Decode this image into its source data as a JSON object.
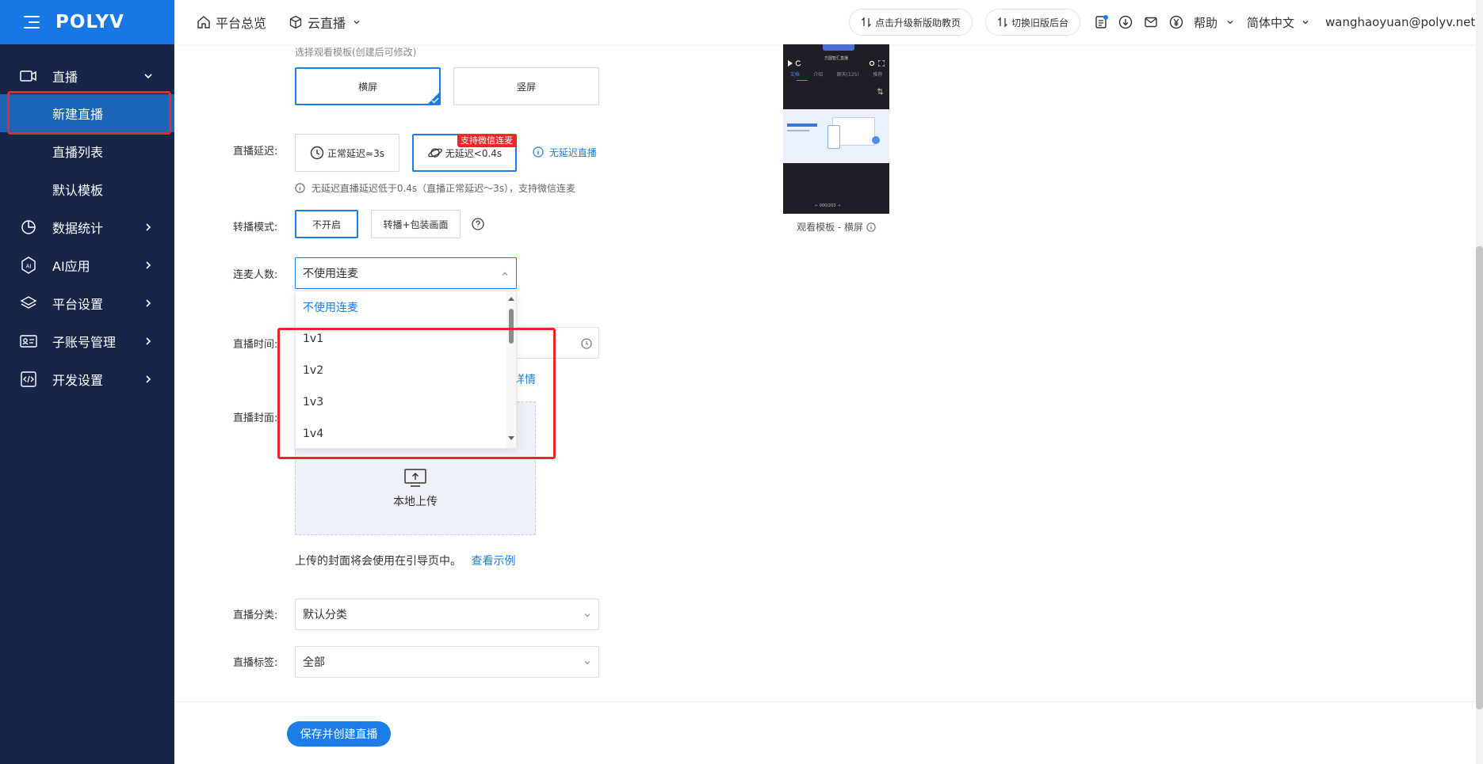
{
  "brand": {
    "logo": "POLYV"
  },
  "sidebar": {
    "sections": [
      {
        "label": "直播",
        "icon": "video-camera-icon",
        "expanded": true,
        "children": [
          {
            "label": "新建直播",
            "active": true
          },
          {
            "label": "直播列表"
          },
          {
            "label": "默认模板"
          }
        ]
      },
      {
        "label": "数据统计",
        "icon": "pie-chart-icon"
      },
      {
        "label": "AI应用",
        "icon": "ai-hexagon-icon"
      },
      {
        "label": "平台设置",
        "icon": "layers-icon"
      },
      {
        "label": "子账号管理",
        "icon": "id-card-icon"
      },
      {
        "label": "开发设置",
        "icon": "code-icon"
      }
    ]
  },
  "topbar": {
    "home": "平台总览",
    "product": "云直播",
    "upgrade_pill": "点击升级新版助教页",
    "old_pill": "切换旧版后台",
    "help": "帮助",
    "language": "简体中文",
    "user": "wanghaoyuan@polyv.net"
  },
  "form": {
    "template_hint": "选择观看模板(创建后可修改)",
    "template_options": [
      "横屏",
      "竖屏"
    ],
    "template_selected": 0,
    "delay_label": "直播延迟:",
    "delay_options": [
      "正常延迟≈3s",
      "无延迟<0.4s"
    ],
    "delay_selected": 1,
    "delay_badge": "支持微信连麦",
    "delay_link": "无延迟直播",
    "delay_note": "无延迟直播延迟低于0.4s（直播正常延迟～3s），支持微信连麦",
    "relay_label": "转播模式:",
    "relay_options": [
      "不开启",
      "转播+包装画面"
    ],
    "relay_selected": 0,
    "mic_label": "连麦人数:",
    "mic_value": "不使用连麦",
    "mic_options": [
      "不使用连麦",
      "1v1",
      "1v2",
      "1v3",
      "1v4"
    ],
    "time_label": "直播时间:",
    "detail_link_fragment": "详情",
    "cover_label": "直播封面:",
    "upload_text": "本地上传",
    "cover_note": "上传的封面将会使用在引导页中。",
    "cover_example_link": "查看示例",
    "category_label": "直播分类:",
    "category_value": "默认分类",
    "tag_label": "直播标签:",
    "tag_value": "全部",
    "save_button": "保存并创建直播"
  },
  "preview": {
    "caption": "观看模板 - 横屏",
    "screen_title": "方圆智汇直播",
    "tabs": [
      "文档",
      "介绍",
      "聊天(125)",
      "推荐"
    ],
    "page_counter": "000/203"
  },
  "colors": {
    "accent": "#1b7ee8",
    "sidebar": "#172548",
    "brand": "#1677e5",
    "highlight": "#e8262d",
    "badge": "#f5222d"
  }
}
